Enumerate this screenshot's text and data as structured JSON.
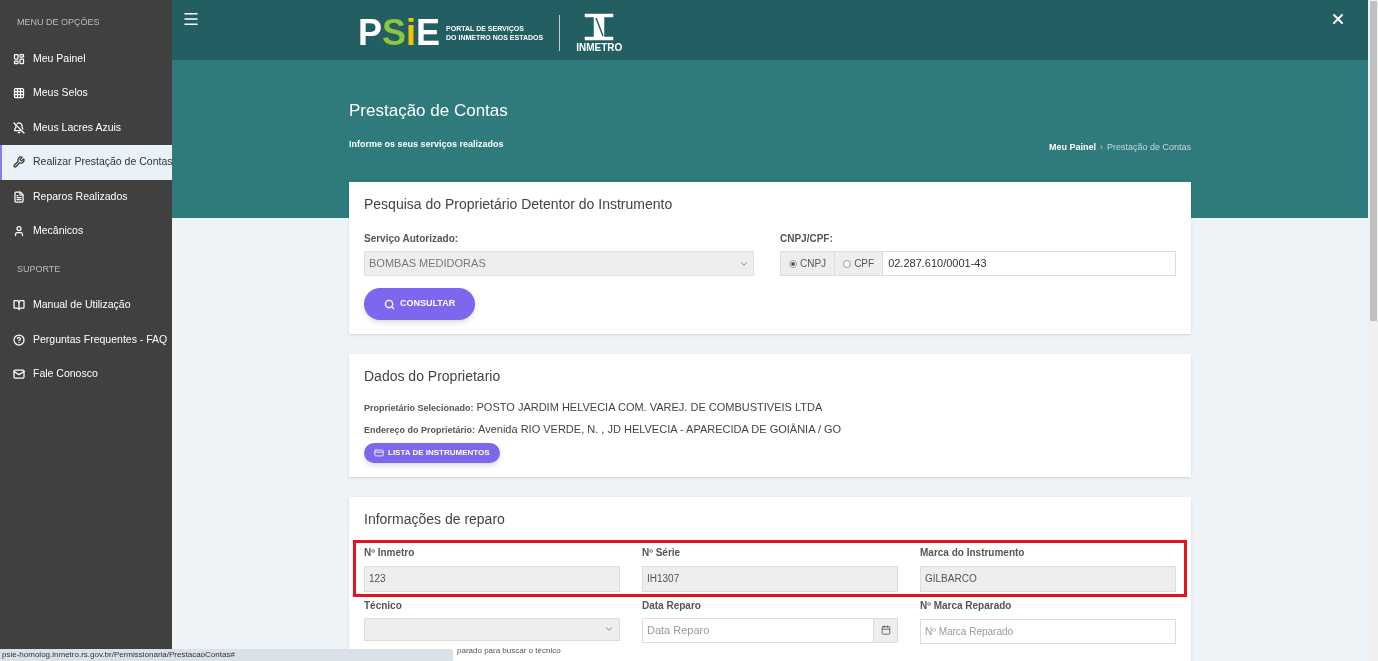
{
  "sidebar": {
    "sections": [
      {
        "title": "MENU DE OPÇÕES",
        "items": [
          {
            "label": "Meu Painel",
            "selected": false
          },
          {
            "label": "Meus Selos",
            "selected": false
          },
          {
            "label": "Meus Lacres Azuis",
            "selected": false
          },
          {
            "label": "Realizar Prestação de Contas",
            "selected": true
          },
          {
            "label": "Reparos Realizados",
            "selected": false
          },
          {
            "label": "Mecânicos",
            "selected": false
          }
        ]
      },
      {
        "title": "SUPORTE",
        "items": [
          {
            "label": "Manual de Utilização",
            "selected": false
          },
          {
            "label": "Perguntas Frequentes - FAQ",
            "selected": false
          },
          {
            "label": "Fale Conosco",
            "selected": false
          }
        ]
      }
    ]
  },
  "header": {
    "logo_letters": [
      "P",
      "S",
      "i",
      "E"
    ],
    "logo_caption": [
      "PORTAL DE SERVIÇOS",
      "DO INMETRO NOS ESTADOS"
    ],
    "inmetro": "INMETRO"
  },
  "page": {
    "title": "Prestação de Contas",
    "subtitle": "Informe os seus serviços realizados",
    "breadcrumb_separator": "›",
    "breadcrumb": [
      {
        "label": "Meu Painel",
        "current": false
      },
      {
        "label": "Prestação de Contas",
        "current": true
      }
    ]
  },
  "search_card": {
    "title": "Pesquisa do Proprietário Detentor do Instrumento",
    "service_label": "Serviço Autorizado:",
    "service_value": "BOMBAS MEDIDORAS",
    "doc_label": "CNPJ/CPF:",
    "doc_types": [
      {
        "label": "CNPJ",
        "selected": true
      },
      {
        "label": "CPF",
        "selected": false
      }
    ],
    "doc_value": "02.287.610/0001-43",
    "button": "CONSULTAR"
  },
  "owner_card": {
    "title": "Dados do Proprietario",
    "fields": [
      {
        "label": "Proprietário Selecionado:",
        "value": "POSTO JARDIM HELVECIA COM. VAREJ. DE COMBUSTIVEIS LTDA"
      },
      {
        "label": "Endereço do Proprietário:",
        "value": "Avenida RIO VERDE, N. , JD HELVECIA - APARECIDA DE GOIÂNIA / GO"
      }
    ],
    "button": "LISTA DE INSTRUMENTOS"
  },
  "repair_card": {
    "title": "Informações de reparo",
    "highlighted_fields": [
      {
        "label": "Nº Inmetro",
        "value": "123"
      },
      {
        "label": "Nº Série",
        "value": "IH1307"
      },
      {
        "label": "Marca do Instrumento",
        "value": "GILBARCO"
      }
    ],
    "fields": [
      {
        "kind": "select",
        "label": "Técnico"
      },
      {
        "kind": "date",
        "label": "Data Reparo",
        "placeholder": "Data Reparo"
      },
      {
        "kind": "text",
        "label": "Nº Marca Reparado",
        "placeholder": "Nº Marca Reparado"
      }
    ],
    "hint": "parado para buscar o técnico"
  },
  "status_bar": "psie-homolog.inmetro.rs.gov.br/Permissionaria/PrestacaoContas#"
}
